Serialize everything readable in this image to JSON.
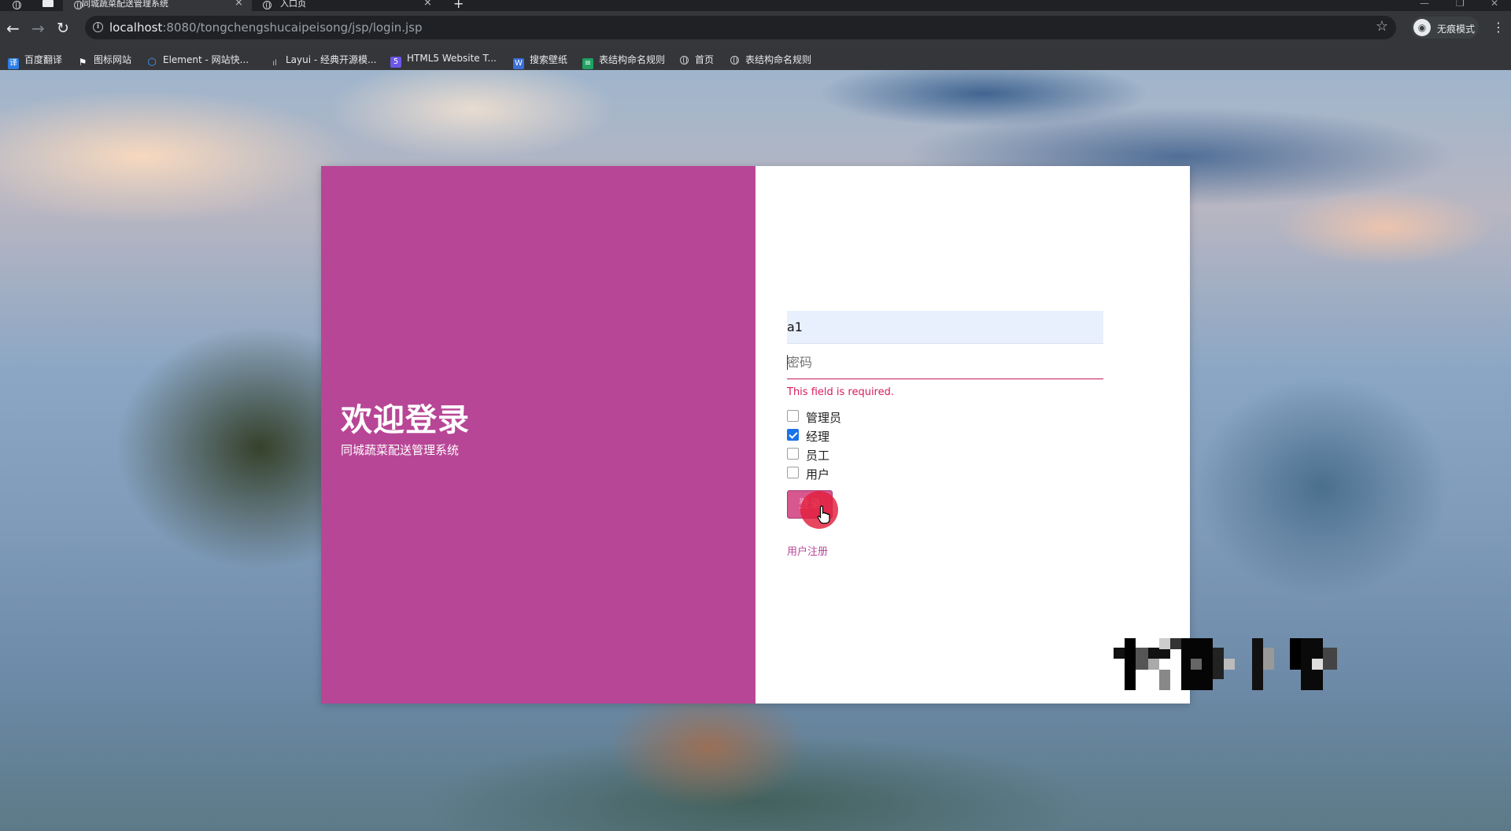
{
  "browser": {
    "tabs": [
      {
        "title": "同城蔬菜配送管理系统",
        "active": true
      },
      {
        "title": "入口页",
        "active": false
      }
    ],
    "new_tab": "+",
    "url_host": "localhost",
    "url_rest": ":8080/tongchengshucaipeisong/jsp/login.jsp",
    "incognito_label": "无痕模式",
    "bookmarks": [
      {
        "label": "百度翻译",
        "icon": "translate-icon",
        "color": "#2b7ee6"
      },
      {
        "label": "图标网站",
        "icon": "flag-icon",
        "color": "#ffffff"
      },
      {
        "label": "Element - 网站快...",
        "icon": "element-icon",
        "color": "#409eff"
      },
      {
        "label": "Layui - 经典开源模...",
        "icon": "layui-icon",
        "color": "#bdbdbd"
      },
      {
        "label": "HTML5 Website T...",
        "icon": "html5-icon",
        "color": "#6b57e8"
      },
      {
        "label": "搜索壁纸",
        "icon": "wallpaper-icon",
        "color": "#3a6fd8"
      },
      {
        "label": "表结构命名规则",
        "icon": "sheet-icon",
        "color": "#1ea362"
      },
      {
        "label": "首页",
        "icon": "globe-icon",
        "color": "#c7c9cc"
      },
      {
        "label": "表结构命名规则",
        "icon": "globe-icon",
        "color": "#c7c9cc"
      }
    ]
  },
  "login": {
    "welcome_title": "欢迎登录",
    "system_name": "同城蔬菜配送管理系统",
    "username_value": "a1",
    "password_placeholder": "密码",
    "error_message": "This field is required.",
    "roles": [
      {
        "label": "管理员",
        "checked": false
      },
      {
        "label": "经理",
        "checked": true
      },
      {
        "label": "员工",
        "checked": false
      },
      {
        "label": "用户",
        "checked": false
      }
    ],
    "login_button": "登录",
    "register_link": "用户注册"
  },
  "colors": {
    "brand_magenta": "#b84696",
    "error_red": "#d81b60",
    "checkbox_blue": "#1a73e8",
    "autofill_bg": "#e8f0fe"
  }
}
